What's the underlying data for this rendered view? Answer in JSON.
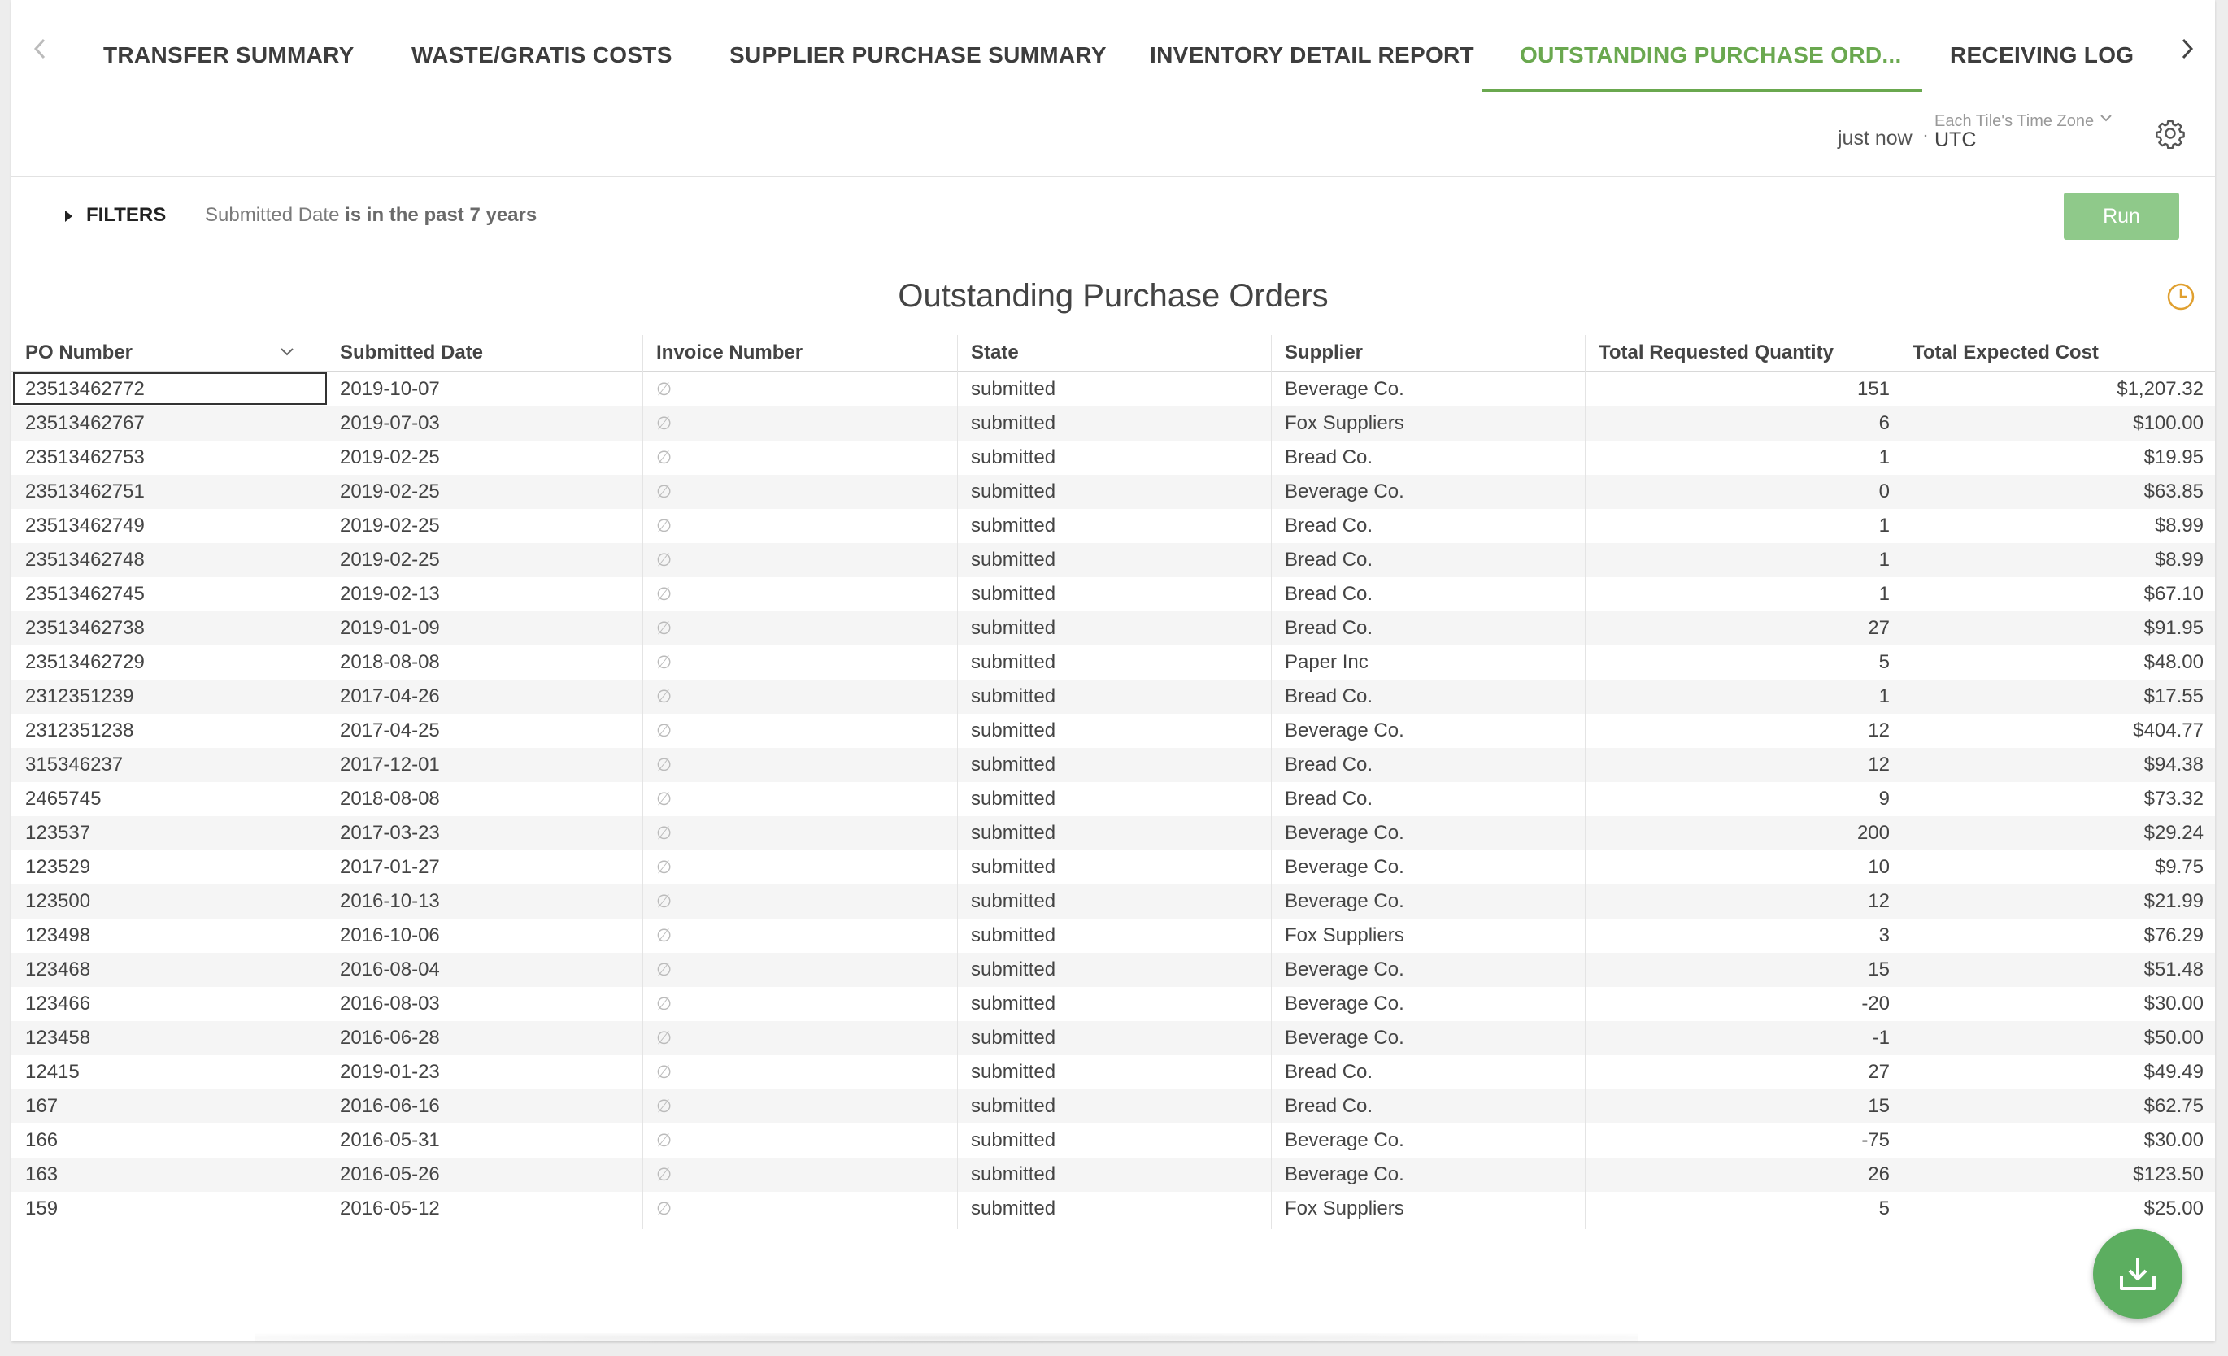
{
  "tabs": [
    {
      "label": "TRANSFER SUMMARY",
      "active": false
    },
    {
      "label": "WASTE/GRATIS COSTS",
      "active": false
    },
    {
      "label": "SUPPLIER PURCHASE SUMMARY",
      "active": false
    },
    {
      "label": "INVENTORY DETAIL REPORT",
      "active": false
    },
    {
      "label": "OUTSTANDING PURCHASE ORD...",
      "active": true
    },
    {
      "label": "RECEIVING LOG",
      "active": false
    }
  ],
  "header": {
    "refreshed": "just now",
    "separator": "·",
    "timezone_caption": "Each Tile's Time Zone",
    "timezone": "UTC"
  },
  "filters": {
    "label": "FILTERS",
    "field": "Submitted Date",
    "condition": "is in the past 7 years"
  },
  "run_label": "Run",
  "report_title": "Outstanding Purchase Orders",
  "columns": [
    "PO Number",
    "Submitted Date",
    "Invoice Number",
    "State",
    "Supplier",
    "Total Requested Quantity",
    "Total Expected Cost"
  ],
  "null_glyph": "∅",
  "rows": [
    {
      "po": "23513462772",
      "date": "2019-10-07",
      "state": "submitted",
      "supplier": "Beverage Co.",
      "qty": "151",
      "cost": "$1,207.32"
    },
    {
      "po": "23513462767",
      "date": "2019-07-03",
      "state": "submitted",
      "supplier": "Fox Suppliers",
      "qty": "6",
      "cost": "$100.00"
    },
    {
      "po": "23513462753",
      "date": "2019-02-25",
      "state": "submitted",
      "supplier": "Bread Co.",
      "qty": "1",
      "cost": "$19.95"
    },
    {
      "po": "23513462751",
      "date": "2019-02-25",
      "state": "submitted",
      "supplier": "Beverage Co.",
      "qty": "0",
      "cost": "$63.85"
    },
    {
      "po": "23513462749",
      "date": "2019-02-25",
      "state": "submitted",
      "supplier": "Bread Co.",
      "qty": "1",
      "cost": "$8.99"
    },
    {
      "po": "23513462748",
      "date": "2019-02-25",
      "state": "submitted",
      "supplier": "Bread Co.",
      "qty": "1",
      "cost": "$8.99"
    },
    {
      "po": "23513462745",
      "date": "2019-02-13",
      "state": "submitted",
      "supplier": "Bread Co.",
      "qty": "1",
      "cost": "$67.10"
    },
    {
      "po": "23513462738",
      "date": "2019-01-09",
      "state": "submitted",
      "supplier": "Bread Co.",
      "qty": "27",
      "cost": "$91.95"
    },
    {
      "po": "23513462729",
      "date": "2018-08-08",
      "state": "submitted",
      "supplier": "Paper Inc",
      "qty": "5",
      "cost": "$48.00"
    },
    {
      "po": "2312351239",
      "date": "2017-04-26",
      "state": "submitted",
      "supplier": "Bread Co.",
      "qty": "1",
      "cost": "$17.55"
    },
    {
      "po": "2312351238",
      "date": "2017-04-25",
      "state": "submitted",
      "supplier": "Beverage Co.",
      "qty": "12",
      "cost": "$404.77"
    },
    {
      "po": "315346237",
      "date": "2017-12-01",
      "state": "submitted",
      "supplier": "Bread Co.",
      "qty": "12",
      "cost": "$94.38"
    },
    {
      "po": "2465745",
      "date": "2018-08-08",
      "state": "submitted",
      "supplier": "Bread Co.",
      "qty": "9",
      "cost": "$73.32"
    },
    {
      "po": "123537",
      "date": "2017-03-23",
      "state": "submitted",
      "supplier": "Beverage Co.",
      "qty": "200",
      "cost": "$29.24"
    },
    {
      "po": "123529",
      "date": "2017-01-27",
      "state": "submitted",
      "supplier": "Beverage Co.",
      "qty": "10",
      "cost": "$9.75"
    },
    {
      "po": "123500",
      "date": "2016-10-13",
      "state": "submitted",
      "supplier": "Beverage Co.",
      "qty": "12",
      "cost": "$21.99"
    },
    {
      "po": "123498",
      "date": "2016-10-06",
      "state": "submitted",
      "supplier": "Fox Suppliers",
      "qty": "3",
      "cost": "$76.29"
    },
    {
      "po": "123468",
      "date": "2016-08-04",
      "state": "submitted",
      "supplier": "Beverage Co.",
      "qty": "15",
      "cost": "$51.48"
    },
    {
      "po": "123466",
      "date": "2016-08-03",
      "state": "submitted",
      "supplier": "Beverage Co.",
      "qty": "-20",
      "cost": "$30.00"
    },
    {
      "po": "123458",
      "date": "2016-06-28",
      "state": "submitted",
      "supplier": "Beverage Co.",
      "qty": "-1",
      "cost": "$50.00"
    },
    {
      "po": "12415",
      "date": "2019-01-23",
      "state": "submitted",
      "supplier": "Bread Co.",
      "qty": "27",
      "cost": "$49.49"
    },
    {
      "po": "167",
      "date": "2016-06-16",
      "state": "submitted",
      "supplier": "Bread Co.",
      "qty": "15",
      "cost": "$62.75"
    },
    {
      "po": "166",
      "date": "2016-05-31",
      "state": "submitted",
      "supplier": "Beverage Co.",
      "qty": "-75",
      "cost": "$30.00"
    },
    {
      "po": "163",
      "date": "2016-05-26",
      "state": "submitted",
      "supplier": "Beverage Co.",
      "qty": "26",
      "cost": "$123.50"
    },
    {
      "po": "159",
      "date": "2016-05-12",
      "state": "submitted",
      "supplier": "Fox Suppliers",
      "qty": "5",
      "cost": "$25.00"
    }
  ],
  "colors": {
    "accent": "#6aa84f",
    "run_button": "#8fc98a",
    "fab": "#5cae60",
    "clock": "#e0a030"
  },
  "icons": [
    "chevron-left-icon",
    "chevron-right-icon",
    "chevron-down-icon",
    "gear-icon",
    "caret-right-icon",
    "clock-icon",
    "download-icon"
  ]
}
